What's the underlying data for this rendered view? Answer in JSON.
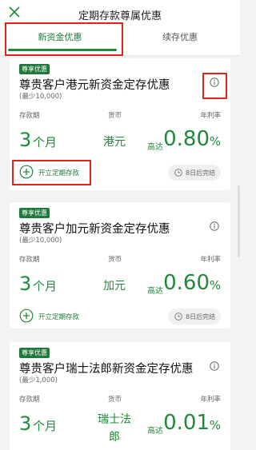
{
  "header": {
    "title": "定期存款尊属优惠",
    "close_icon": "close-icon"
  },
  "tabs": [
    {
      "label": "新资金优惠",
      "active": true
    },
    {
      "label": "续存优惠",
      "active": false
    }
  ],
  "labels": {
    "term": "存款期",
    "currency": "货币",
    "rate": "年利率"
  },
  "cards": [
    {
      "badge": "尊享优惠",
      "title": "尊贵客户港元新资金定存优惠",
      "min": "(最少10,000)",
      "term_num": "3",
      "term_unit": "个月",
      "currency": "港元",
      "upto": "高达",
      "rate": "0.80",
      "pct": "%",
      "open_label": "开立定期存款",
      "maturity": "8日后完结"
    },
    {
      "badge": "尊享优惠",
      "title": "尊贵客户加元新资金定存优惠",
      "min": "(最少10,000)",
      "term_num": "3",
      "term_unit": "个月",
      "currency": "加元",
      "upto": "高达",
      "rate": "0.60",
      "pct": "%",
      "open_label": "开立定期存款",
      "maturity": "8日后完结"
    },
    {
      "badge": "尊享优惠",
      "title": "尊贵客户瑞士法郎新资金定存优惠",
      "min": "(最少1,000)",
      "term_num": "3",
      "term_unit": "个月",
      "currency": "瑞士法郎",
      "upto": "高达",
      "rate": "0.01",
      "pct": "%"
    }
  ],
  "colors": {
    "brand_green": "#1f8a3a",
    "highlight_red": "#e2231a"
  }
}
